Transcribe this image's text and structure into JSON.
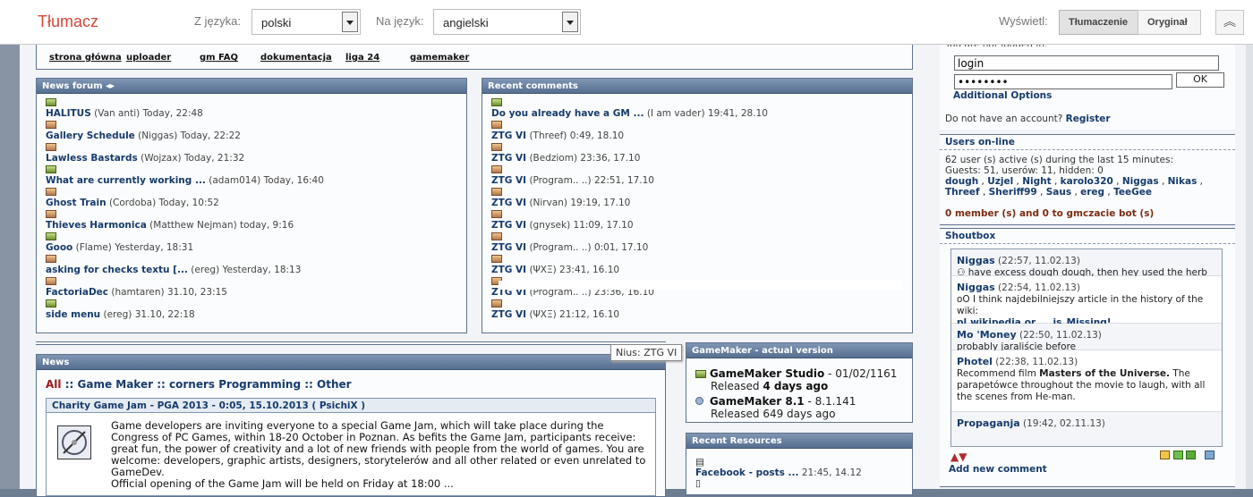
{
  "translate_bar": {
    "brand": "Tłumacz",
    "from_label": "Z języka:",
    "from_value": "polski",
    "to_label": "Na język:",
    "to_value": "angielski",
    "show_label": "Wyświetl:",
    "btn_translation": "Tłumaczenie",
    "btn_original": "Oryginał"
  },
  "top_icons": [
    "strona główna",
    "uploader",
    "gm FAQ",
    "dokumentacja",
    "liga 24",
    "gamemaker"
  ],
  "news_forum": {
    "title": "News forum",
    "items": [
      {
        "title": "HALITUS",
        "meta": "(Van anti) Today, 22:48"
      },
      {
        "title": "Gallery Schedule",
        "meta": "(Niggas) Today, 22:22"
      },
      {
        "title": "Lawless Bastards",
        "meta": "(Wojzax) Today, 21:32"
      },
      {
        "title": "What are currently working ...",
        "meta": "(adam014) Today, 16:40"
      },
      {
        "title": "Ghost Train",
        "meta": "(Cordoba) Today, 10:52"
      },
      {
        "title": "Thieves Harmonica",
        "meta": "(Matthew Nejman) today, 9:16"
      },
      {
        "title": "Gooo",
        "meta": "(Flame) Yesterday, 18:31"
      },
      {
        "title": "asking for checks textu [...",
        "meta": "(ereg) Yesterday, 18:13"
      },
      {
        "title": "FactoriaDec",
        "meta": "(hamtaren) 31.10, 23:15"
      },
      {
        "title": "side menu",
        "meta": "(ereg) 31.10, 22:18"
      }
    ]
  },
  "recent_comments": {
    "title": "Recent comments",
    "items": [
      {
        "title": "Do you already have a GM ...",
        "meta": "(I am vader) 19:41, 28.10"
      },
      {
        "title": "ZTG VI",
        "meta": "(Threef) 0:49, 18.10"
      },
      {
        "title": "ZTG VI",
        "meta": "(Bedziom) 23:36, 17.10"
      },
      {
        "title": "ZTG VI",
        "meta": "(Program.. ..) 22:51, 17.10"
      },
      {
        "title": "ZTG VI",
        "meta": "(Nirvan) 19:19, 17.10"
      },
      {
        "title": "ZTG VI",
        "meta": "(gnysek) 11:09, 17.10"
      },
      {
        "title": "ZTG VI",
        "meta": "(Program.. ..) 0:01, 17.10"
      },
      {
        "title": "ZTG VI",
        "meta": "(ΨΧΞ) 23:41, 16.10"
      },
      {
        "title": "ZTG VI",
        "meta": "(Program.. ..) 23:36, 16.10"
      },
      {
        "title": "ZTG VI",
        "meta": "(ΨΧΞ) 21:12, 16.10"
      }
    ],
    "tooltip": "Nius: ZTG VI"
  },
  "news": {
    "title": "News",
    "tab_all": "All",
    "tab_sep": "::",
    "tab_gm": "Game Maker",
    "tab_corners": "corners Programming",
    "tab_other": "Other",
    "article_title": "Charity Game Jam - PGA 2013 - 0:05, 15.10.2013 ( PsichiX )",
    "article_body": "Game developers are inviting everyone to a special Game Jam, which will take place during the Congress of PC Games, within 18-20 October in Poznan. As befits the Game Jam, participants receive: great fun, the power of creativity and a lot of new friends with people from the world of games. You are welcome: developers, graphic artists, designers, storytelerów and all other related or even unrelated to GameDev.",
    "article_body_cut": "Official opening of the Game Jam will be held on Friday at 18:00 ..."
  },
  "gm_version": {
    "title": "GameMaker - actual version",
    "studio_name": "GameMaker Studio",
    "studio_ver": "- 01/02/1161",
    "studio_rel_pre": "Released",
    "studio_rel": "4 days ago",
    "gm8_name": "GameMaker 8.1",
    "gm8_ver": "- 8.1.141",
    "gm8_rel": "Released 649 days ago"
  },
  "recent_resources": {
    "title": "Recent Resources",
    "item_title": "Facebook - posts ...",
    "item_meta": "21:45, 14.12"
  },
  "login": {
    "header_text": "You are not logged in.",
    "login_value": "login",
    "password_value": "••••••••",
    "ok": "OK",
    "additional": "Additional Options",
    "no_account": "Do not have an account?",
    "register": "Register"
  },
  "users_online": {
    "title": "Users on-line",
    "line1": "62 user (s) active (s) during the last 15 minutes:",
    "line2": "Guests: 51, userów: 11, hidden: 0",
    "users_row1": [
      "dough",
      "Uzjel",
      "Night",
      "karolo320",
      "Niggas",
      "Nikas"
    ],
    "users_row2": [
      "Threef",
      "Sheriff99",
      "Saus",
      "ereg",
      "TeeGee"
    ],
    "bots": "0 member (s) and 0 to gmczacie bot (s)"
  },
  "shoutbox": {
    "title": "Shoutbox",
    "msgs": [
      {
        "name": "Niggas",
        "meta": "(22:57, 11.02.13)",
        "text": "have excess dough dough, then hey used the herb"
      },
      {
        "name": "Niggas",
        "meta": "(22:54, 11.02.13)",
        "text": "oO I think najdebilniejszy article in the history of the wiki:",
        "link": "pl.wikipedia.or ... is_Missing!"
      },
      {
        "name": "Mo 'Money",
        "meta": "(22:50, 11.02.13)",
        "text": "probably jaraliście before"
      },
      {
        "name": "Photel",
        "meta": "(22:38, 11.02.13)",
        "text_pre": "Recommend film",
        "bold": "Masters of the Universe.",
        "text_post": "The parapetówce throughout the movie to laugh, with all the scenes from He-man."
      },
      {
        "name": "Propaganja",
        "meta": "(19:42, 02.11.13)",
        "text": ""
      }
    ],
    "add_comment": "Add new comment"
  }
}
